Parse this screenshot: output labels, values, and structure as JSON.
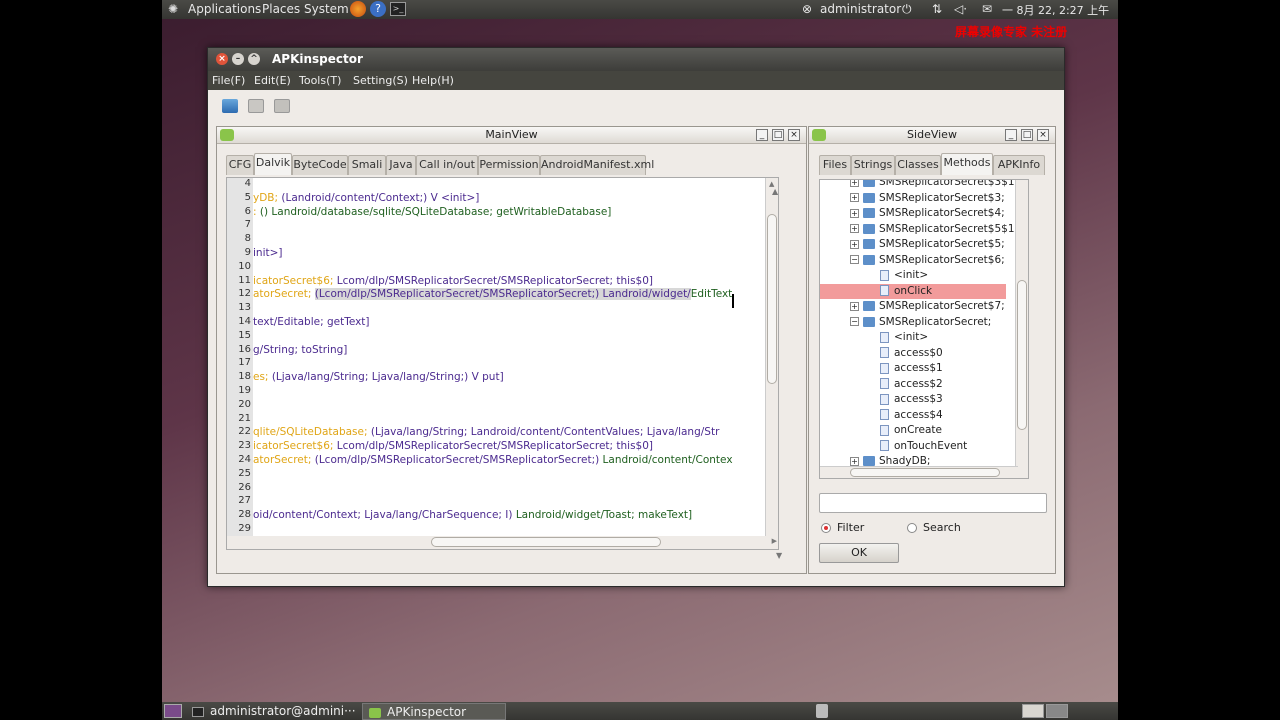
{
  "topbar": {
    "applications": "Applications",
    "places": "Places",
    "system": "System",
    "user": "administrator",
    "datetime": "一 8月 22, 2:27 上午"
  },
  "watermark": "屏幕录像专家 未注册",
  "window": {
    "title": "APKinspector"
  },
  "menu": [
    "File(F)",
    "Edit(E)",
    "Tools(T)",
    "Setting(S)",
    "Help(H)"
  ],
  "mainview": {
    "title": "MainView",
    "tabs": [
      "CFG",
      "Dalvik",
      "ByteCode",
      "Smali",
      "Java",
      "Call in/out",
      "Permission",
      "AndroidManifest.xml"
    ],
    "active_tab": "Dalvik",
    "lines": [
      {
        "n": "4",
        "seg": []
      },
      {
        "n": "5",
        "seg": [
          [
            "y",
            "yDB; "
          ],
          [
            "p",
            "(Landroid/content/Context;) V <init>]"
          ]
        ]
      },
      {
        "n": "6",
        "seg": [
          [
            "y",
            ": "
          ],
          [
            "g",
            "() Landroid/database/sqlite/SQLiteDatabase; getWritableDatabase]"
          ]
        ]
      },
      {
        "n": "7",
        "seg": []
      },
      {
        "n": "8",
        "seg": []
      },
      {
        "n": "9",
        "seg": [
          [
            "p",
            "init>]"
          ]
        ]
      },
      {
        "n": "10",
        "seg": []
      },
      {
        "n": "11",
        "seg": [
          [
            "y",
            "icatorSecret$6; "
          ],
          [
            "p",
            "Lcom/dlp/SMSReplicatorSecret/SMSReplicatorSecret; this$0]"
          ]
        ]
      },
      {
        "n": "12",
        "seg": [
          [
            "y",
            "atorSecret; "
          ],
          [
            "h",
            "(Lcom/dlp/SMSReplicatorSecret/SMSReplicatorSecret;) Landroid/widget/"
          ],
          [
            "g",
            "EditText"
          ]
        ]
      },
      {
        "n": "13",
        "seg": []
      },
      {
        "n": "14",
        "seg": [
          [
            "p",
            "text/Editable; getText]"
          ]
        ]
      },
      {
        "n": "15",
        "seg": []
      },
      {
        "n": "16",
        "seg": [
          [
            "p",
            "g/String; toString]"
          ]
        ]
      },
      {
        "n": "17",
        "seg": []
      },
      {
        "n": "18",
        "seg": [
          [
            "y",
            "es; "
          ],
          [
            "p",
            "(Ljava/lang/String; Ljava/lang/String;) V put]"
          ]
        ]
      },
      {
        "n": "19",
        "seg": []
      },
      {
        "n": "20",
        "seg": []
      },
      {
        "n": "21",
        "seg": []
      },
      {
        "n": "22",
        "seg": [
          [
            "y",
            "qlite/SQLiteDatabase; "
          ],
          [
            "p",
            "(Ljava/lang/String; Landroid/content/ContentValues; Ljava/lang/Str"
          ]
        ]
      },
      {
        "n": "23",
        "seg": [
          [
            "y",
            "icatorSecret$6; "
          ],
          [
            "p",
            "Lcom/dlp/SMSReplicatorSecret/SMSReplicatorSecret; this$0]"
          ]
        ]
      },
      {
        "n": "24",
        "seg": [
          [
            "y",
            "atorSecret; "
          ],
          [
            "p",
            "(Lcom/dlp/SMSReplicatorSecret/SMSReplicatorSecret;) "
          ],
          [
            "g",
            "Landroid/content/Contex"
          ]
        ]
      },
      {
        "n": "25",
        "seg": []
      },
      {
        "n": "26",
        "seg": []
      },
      {
        "n": "27",
        "seg": []
      },
      {
        "n": "28",
        "seg": [
          [
            "p",
            "oid/content/Context; Ljava/lang/CharSequence; I) "
          ],
          [
            "g",
            "Landroid/widget/Toast; makeText]"
          ]
        ]
      },
      {
        "n": "29",
        "seg": []
      }
    ]
  },
  "sideview": {
    "title": "SideView",
    "tabs": [
      "Files",
      "Strings",
      "Classes",
      "Methods",
      "APKInfo"
    ],
    "active_tab": "Methods",
    "tree": [
      {
        "t": "SMSReplicatorSecret$3$1;",
        "k": "class",
        "e": "+",
        "lvl": 0
      },
      {
        "t": "SMSReplicatorSecret$3;",
        "k": "class",
        "e": "+",
        "lvl": 0
      },
      {
        "t": "SMSReplicatorSecret$4;",
        "k": "class",
        "e": "+",
        "lvl": 0
      },
      {
        "t": "SMSReplicatorSecret$5$1;",
        "k": "class",
        "e": "+",
        "lvl": 0
      },
      {
        "t": "SMSReplicatorSecret$5;",
        "k": "class",
        "e": "+",
        "lvl": 0
      },
      {
        "t": "SMSReplicatorSecret$6;",
        "k": "class",
        "e": "−",
        "lvl": 0
      },
      {
        "t": "<init>",
        "k": "method",
        "lvl": 1
      },
      {
        "t": "onClick",
        "k": "method",
        "lvl": 1,
        "sel": true
      },
      {
        "t": "SMSReplicatorSecret$7;",
        "k": "class",
        "e": "+",
        "lvl": 0
      },
      {
        "t": "SMSReplicatorSecret;",
        "k": "class",
        "e": "−",
        "lvl": 0
      },
      {
        "t": "<init>",
        "k": "method",
        "lvl": 1
      },
      {
        "t": "access$0",
        "k": "method",
        "lvl": 1
      },
      {
        "t": "access$1",
        "k": "method",
        "lvl": 1
      },
      {
        "t": "access$2",
        "k": "method",
        "lvl": 1
      },
      {
        "t": "access$3",
        "k": "method",
        "lvl": 1
      },
      {
        "t": "access$4",
        "k": "method",
        "lvl": 1
      },
      {
        "t": "onCreate",
        "k": "method",
        "lvl": 1
      },
      {
        "t": "onTouchEvent",
        "k": "method",
        "lvl": 1
      },
      {
        "t": "ShadyDB;",
        "k": "class",
        "e": "+",
        "lvl": 0
      }
    ],
    "filter_value": "",
    "radio_filter": "Filter",
    "radio_search": "Search",
    "ok": "OK"
  },
  "taskbar": {
    "terminal": "administrator@admini···",
    "app": "APKinspector"
  },
  "colors": {
    "accent_selection": "#f29b9b",
    "code_purple": "#4b2a8f",
    "code_yellow": "#e0a516",
    "code_green": "#206020"
  }
}
